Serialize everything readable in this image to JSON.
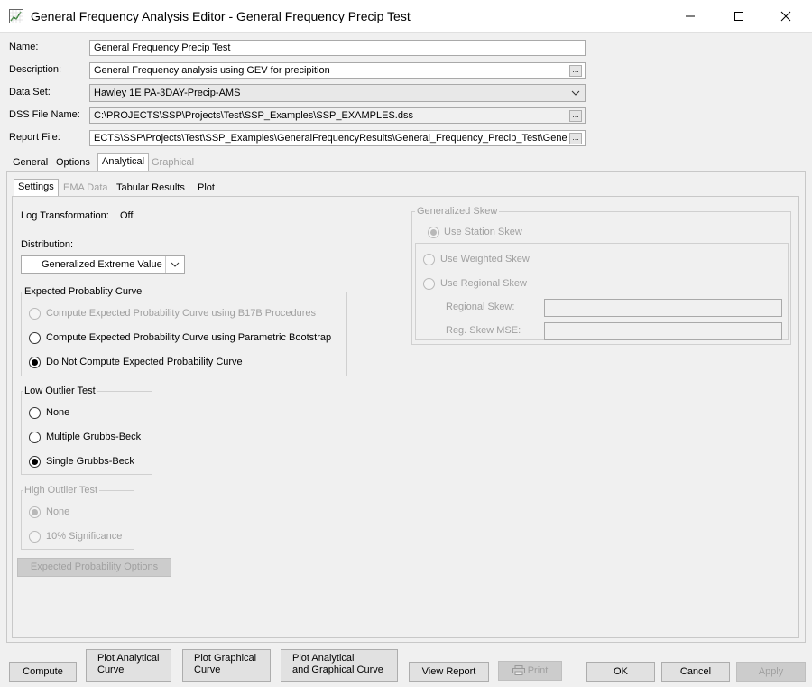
{
  "window": {
    "title": "General Frequency Analysis Editor - General Frequency Precip Test",
    "minimize": "—",
    "maximize": "☐",
    "close": "✕"
  },
  "form": {
    "name_label": "Name:",
    "name_value": "General Frequency Precip Test",
    "description_label": "Description:",
    "description_value": "General Frequency analysis using GEV for precipition",
    "dataset_label": "Data Set:",
    "dataset_value": "Hawley 1E PA-3DAY-Precip-AMS",
    "dss_label": "DSS File Name:",
    "dss_value": "C:\\PROJECTS\\SSP\\Projects\\Test\\SSP_Examples\\SSP_EXAMPLES.dss",
    "report_label": "Report File:",
    "report_value": "ECTS\\SSP\\Projects\\Test\\SSP_Examples\\GeneralFrequencyResults\\General_Frequency_Precip_Test\\Gene",
    "ellipsis": "..."
  },
  "main_tabs": [
    "General",
    "Options",
    "Analytical",
    "Graphical"
  ],
  "sub_tabs": [
    "Settings",
    "EMA Data",
    "Tabular Results",
    "Plot"
  ],
  "settings": {
    "log_transform_label": "Log Transformation:",
    "log_transform_value": "Off",
    "distribution_label": "Distribution:",
    "distribution_value": "Generalized Extreme Value",
    "expected_prob": {
      "title": "Expected Probablity Curve",
      "options": [
        "Compute Expected Probability Curve using B17B Procedures",
        "Compute Expected Probability Curve using Parametric Bootstrap",
        "Do Not Compute Expected Probability Curve"
      ]
    },
    "low_outlier": {
      "title": "Low Outlier Test",
      "options": [
        "None",
        "Multiple Grubbs-Beck",
        "Single Grubbs-Beck"
      ]
    },
    "high_outlier": {
      "title": "High Outlier Test",
      "options": [
        "None",
        "10% Significance"
      ]
    },
    "expected_options_button": "Expected Probability Options",
    "gen_skew": {
      "title": "Generalized Skew",
      "station": "Use Station Skew",
      "weighted": "Use Weighted Skew",
      "regional": "Use Regional Skew",
      "regional_skew_label": "Regional Skew:",
      "reg_skew_mse_label": "Reg. Skew MSE:"
    }
  },
  "buttons": {
    "compute": "Compute",
    "plot_analytical_1": "Plot Analytical",
    "plot_analytical_2": "Curve",
    "plot_graphical_1": "Plot Graphical",
    "plot_graphical_2": "Curve",
    "plot_both_1": "Plot Analytical",
    "plot_both_2": "and Graphical Curve",
    "view_report": "View Report",
    "print": "Print",
    "ok": "OK",
    "cancel": "Cancel",
    "apply": "Apply"
  }
}
